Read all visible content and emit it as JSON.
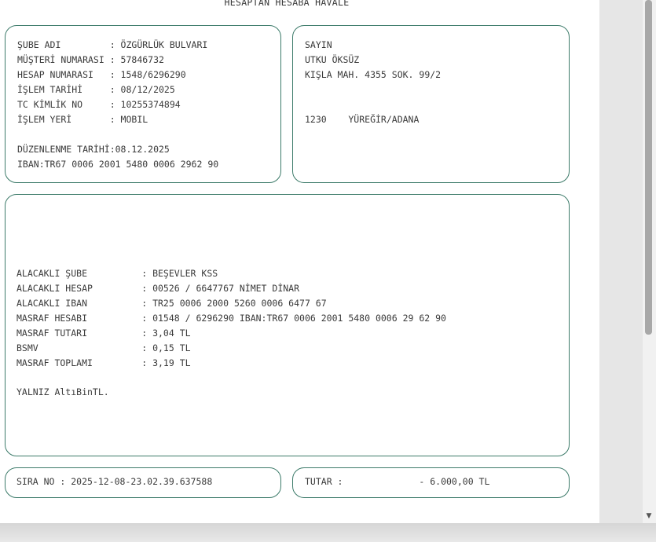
{
  "document": {
    "title": "HESAPTAN HESABA HAVALE",
    "sender": {
      "lines": [
        "ŞUBE ADI         : ÖZGÜRLÜK BULVARI",
        "MÜŞTERİ NUMARASI : 57846732",
        "HESAP NUMARASI   : 1548/6296290",
        "İŞLEM TARİHİ     : 08/12/2025",
        "TC KİMLİK NO     : 10255374894",
        "İŞLEM YERİ       : MOBIL",
        "",
        "DÜZENLENME TARİHİ:08.12.2025",
        "IBAN:TR67 0006 2001 5480 0006 2962 90"
      ]
    },
    "recipient": {
      "lines": [
        "SAYIN",
        "UTKU ÖKSÜZ",
        "KIŞLA MAH. 4355 SOK. 99/2",
        "",
        "",
        "1230    YÜREĞİR/ADANA"
      ]
    },
    "details": {
      "lines": [
        "ALACAKLI ŞUBE          : BEŞEVLER KSS",
        "ALACAKLI HESAP         : 00526 / 6647767 NİMET DİNAR",
        "ALACAKLI IBAN          : TR25 0006 2000 5260 0006 6477 67",
        "MASRAF HESABI          : 01548 / 6296290 IBAN:TR67 0006 2001 5480 0006 29 62 90",
        "MASRAF TUTARI          : 3,04 TL",
        "BSMV                   : 0,15 TL",
        "MASRAF TOPLAMI         : 3,19 TL",
        "",
        "YALNIZ AltıBinTL."
      ]
    },
    "sequence": "SIRA NO : 2025-12-08-23.02.39.637588",
    "amount": "TUTAR :              - 6.000,00 TL"
  }
}
